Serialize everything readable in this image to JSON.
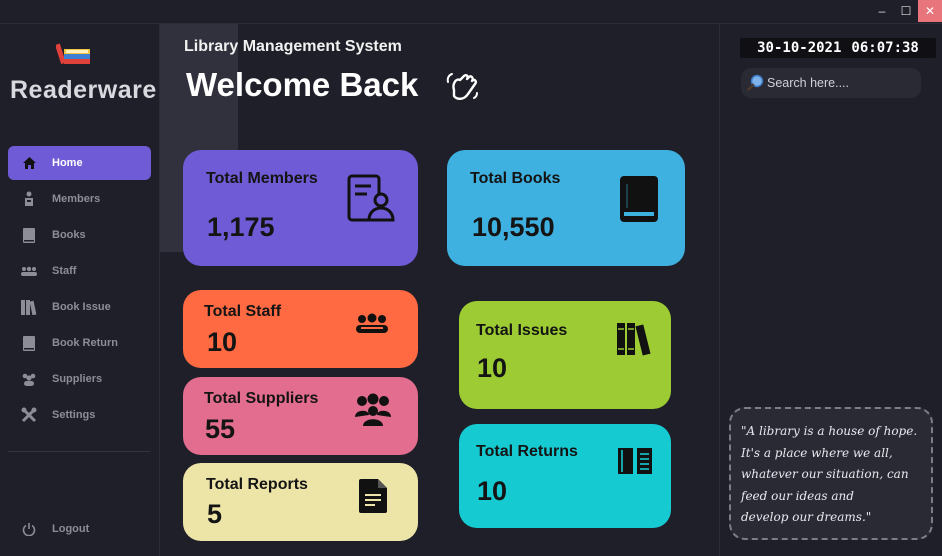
{
  "window": {
    "minimize": "–",
    "maximize": "☐",
    "close": "✕"
  },
  "sidebar": {
    "brand": "Readerware",
    "items": [
      {
        "label": "Home",
        "icon": "home-icon"
      },
      {
        "label": "Members",
        "icon": "members-icon"
      },
      {
        "label": "Books",
        "icon": "book-icon"
      },
      {
        "label": "Staff",
        "icon": "staff-icon"
      },
      {
        "label": "Book Issue",
        "icon": "book-issue-icon"
      },
      {
        "label": "Book Return",
        "icon": "book-return-icon"
      },
      {
        "label": "Suppliers",
        "icon": "suppliers-icon"
      },
      {
        "label": "Settings",
        "icon": "settings-icon"
      }
    ],
    "logout": "Logout",
    "active_color": "#6f5bd6"
  },
  "header": {
    "subtitle": "Library Management System",
    "welcome": "Welcome Back"
  },
  "cards": {
    "members": {
      "title": "Total Members",
      "value": "1,175",
      "color": "#6f5bd6"
    },
    "books": {
      "title": "Total Books",
      "value": "10,550",
      "color": "#3fb1e0"
    },
    "staff": {
      "title": "Total Staff",
      "value": "10",
      "color": "#ff6a42"
    },
    "suppliers": {
      "title": "Total Suppliers",
      "value": "55",
      "color": "#e26d8e"
    },
    "reports": {
      "title": "Total Reports",
      "value": "5",
      "color": "#ede4a8"
    },
    "issues": {
      "title": "Total Issues",
      "value": "10",
      "color": "#9ccb33"
    },
    "returns": {
      "title": "Total Returns",
      "value": "10",
      "color": "#15cad1"
    }
  },
  "right": {
    "date": "30-10-2021",
    "time": "06:07:38",
    "search_placeholder": "Search here....",
    "quote_lines": [
      "\"A library is a house of hope.",
      "It's a place where we all,",
      "whatever our situation, can",
      "feed our ideas and",
      "develop our dreams.\""
    ]
  }
}
